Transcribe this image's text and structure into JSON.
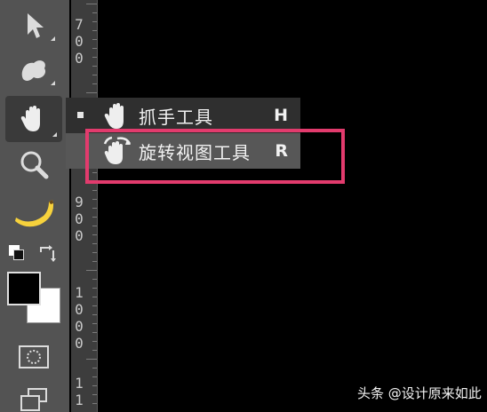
{
  "toolbar": {
    "tools": [
      {
        "name": "move-tool",
        "icon": "arrow-icon"
      },
      {
        "name": "lasso-tool",
        "icon": "lasso-icon"
      },
      {
        "name": "hand-tool",
        "icon": "hand-icon",
        "active": true
      },
      {
        "name": "zoom-tool",
        "icon": "magnifier-icon"
      },
      {
        "name": "banana-tool",
        "icon": "banana-icon"
      },
      {
        "name": "color-swatches",
        "icon": "default-colors-icon"
      },
      {
        "name": "quick-mask",
        "icon": "quick-mask-icon"
      },
      {
        "name": "screen-mode",
        "icon": "screen-mode-icon"
      }
    ],
    "foreground_color": "#000000",
    "background_color": "#ffffff"
  },
  "ruler": {
    "groups": [
      {
        "digits": [
          "7",
          "0",
          "0"
        ]
      },
      {
        "digits": [
          "9",
          "0",
          "0"
        ]
      },
      {
        "digits": [
          "1",
          "0",
          "0",
          "0"
        ]
      },
      {
        "digits": [
          "1",
          "1"
        ]
      }
    ]
  },
  "flyout": {
    "items": [
      {
        "label": "抓手工具",
        "shortcut": "H",
        "selected": true
      },
      {
        "label": "旋转视图工具",
        "shortcut": "R",
        "hover": true
      }
    ]
  },
  "highlight_color": "#e23b6d",
  "watermark": "头条 @设计原来如此"
}
